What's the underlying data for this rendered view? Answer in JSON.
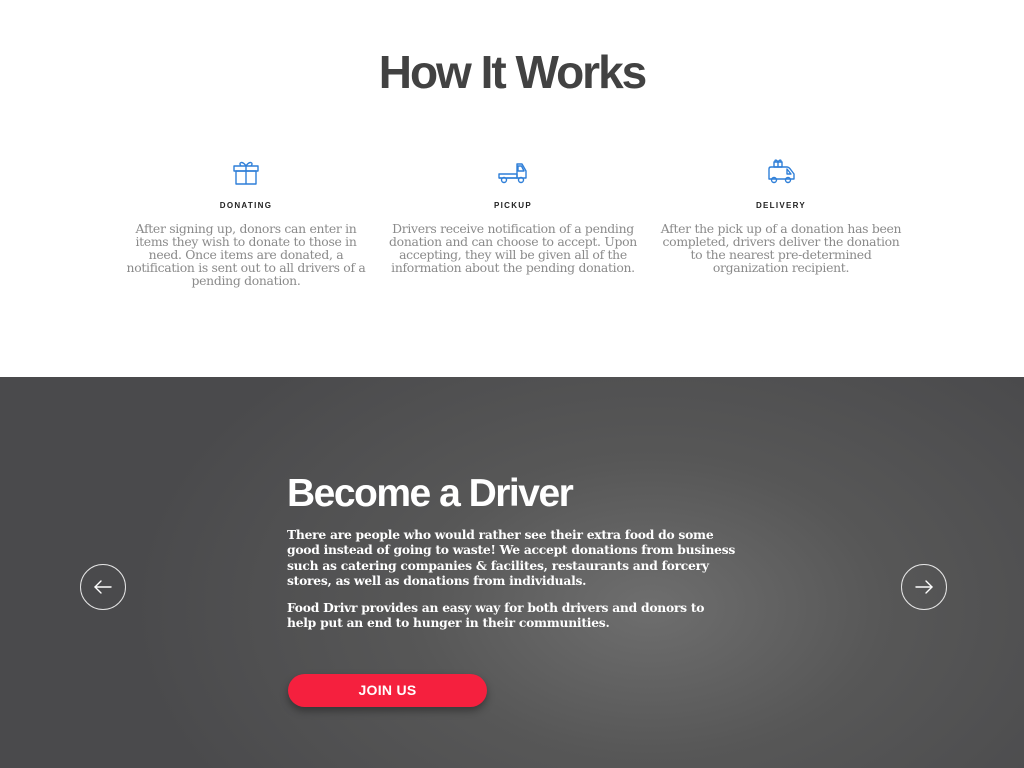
{
  "how_it_works": {
    "title": "How It Works",
    "accent_color": "#2f7fd8",
    "steps": [
      {
        "icon": "gift-box-icon",
        "title": "DONATING",
        "text": "After signing up, donors can enter in items they wish to donate to those in need. Once items are donated, a notification is sent out to all drivers of a pending donation."
      },
      {
        "icon": "truck-icon",
        "title": "PICKUP",
        "text": "Drivers receive notification of a pending donation and can choose to accept. Upon accepting, they will be given all of the information about the pending donation."
      },
      {
        "icon": "delivery-van-gift-icon",
        "title": "DELIVERY",
        "text": "After the pick up of a donation has been completed, drivers deliver the donation to the nearest pre-determined organization recipient."
      }
    ]
  },
  "driver": {
    "title": "Become a Driver",
    "paragraph1": "There are people who would rather see their extra food do some good instead of going to waste! We accept donations from business such as catering companies & facilites, restaurants and forcery stores, as well as donations from individuals.",
    "paragraph2": "Food Drivr provides an easy way for both drivers and donors to help put an end to hunger in their communities.",
    "button_label": "JOIN US",
    "button_color": "#f5203e",
    "prev_icon": "arrow-left-icon",
    "next_icon": "arrow-right-icon"
  }
}
